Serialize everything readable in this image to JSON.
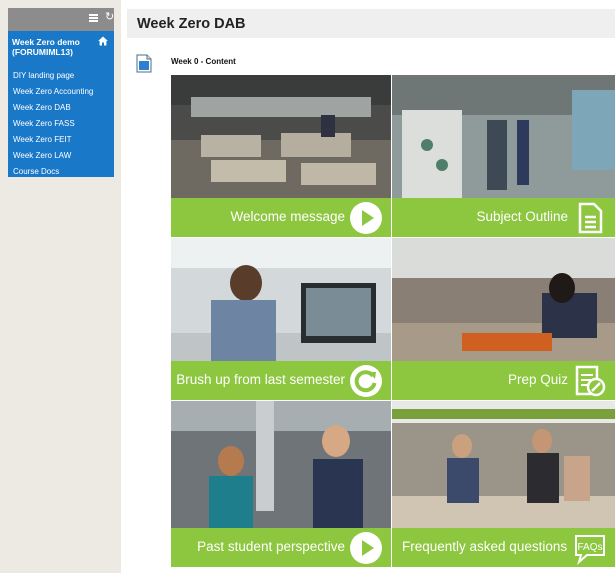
{
  "sidebar": {
    "course_title": "Week Zero demo (FORUMIML13)",
    "items": [
      {
        "label": "DIY landing page"
      },
      {
        "label": "Week Zero Accounting"
      },
      {
        "label": "Week Zero DAB"
      },
      {
        "label": "Week Zero FASS"
      },
      {
        "label": "Week Zero FEIT"
      },
      {
        "label": "Week Zero LAW"
      },
      {
        "label": "Course Docs"
      }
    ]
  },
  "page": {
    "title": "Week Zero DAB",
    "item_title": "Week 0 - Content"
  },
  "tiles": [
    {
      "label": "Welcome message",
      "icon": "play-icon"
    },
    {
      "label": "Subject Outline",
      "icon": "document-icon"
    },
    {
      "label": "Brush up from last semester",
      "icon": "refresh-icon"
    },
    {
      "label": "Prep Quiz",
      "icon": "quiz-icon"
    },
    {
      "label": "Past student perspective",
      "icon": "play-icon"
    },
    {
      "label": "Frequently asked questions",
      "icon": "faq-icon"
    }
  ],
  "colors": {
    "menu_blue": "#1a78c8",
    "tile_green": "#8dc63f",
    "left_bg": "#eceae3"
  }
}
